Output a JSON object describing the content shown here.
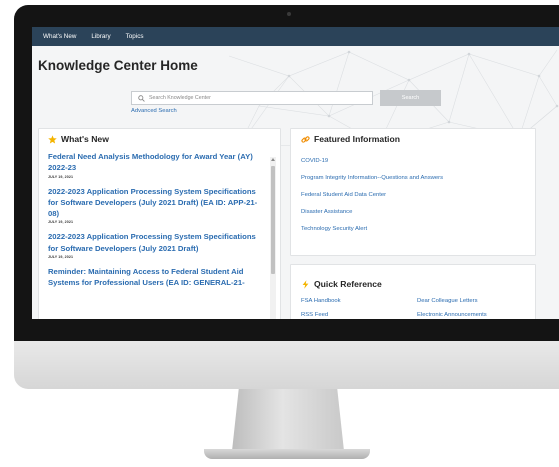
{
  "nav": {
    "items": [
      "What's New",
      "Library",
      "Topics"
    ]
  },
  "page": {
    "title": "Knowledge Center Home"
  },
  "search": {
    "placeholder": "Search Knowledge Center",
    "button_label": "Search",
    "advanced_label": "Advanced Search"
  },
  "whats_new": {
    "title": "What's New",
    "items": [
      {
        "title": "Federal Need Analysis Methodology for Award Year (AY) 2022-23",
        "date": "JULY 19, 2021"
      },
      {
        "title": "2022-2023 Application Processing System Specifications for Software Developers (July 2021 Draft) (EA ID: APP-21-08)",
        "date": "JULY 19, 2021"
      },
      {
        "title": "2022-2023 Application Processing System Specifications for Software Developers (July 2021 Draft)",
        "date": "JULY 19, 2021"
      },
      {
        "title": "Reminder: Maintaining Access to Federal Student Aid Systems for Professional Users (EA ID: GENERAL-21-",
        "date": ""
      }
    ]
  },
  "featured": {
    "title": "Featured Information",
    "links": [
      "COVID-19",
      "Program Integrity Information--Questions and Answers",
      "Federal Student Aid Data Center",
      "Disaster Assistance",
      "Technology Security Alert"
    ]
  },
  "quick_reference": {
    "title": "Quick Reference",
    "links": [
      "FSA Handbook",
      "Dear Colleague Letters",
      "RSS Feed",
      "Electronic Announcements"
    ]
  },
  "colors": {
    "nav_bg": "#2b4359",
    "link": "#2b6cb0",
    "star": "#f4b400",
    "accent_orange": "#f08c00"
  },
  "icons": {
    "whats_new": "star-icon",
    "featured": "link-icon",
    "quick_reference": "lightning-icon",
    "search": "search-icon"
  }
}
